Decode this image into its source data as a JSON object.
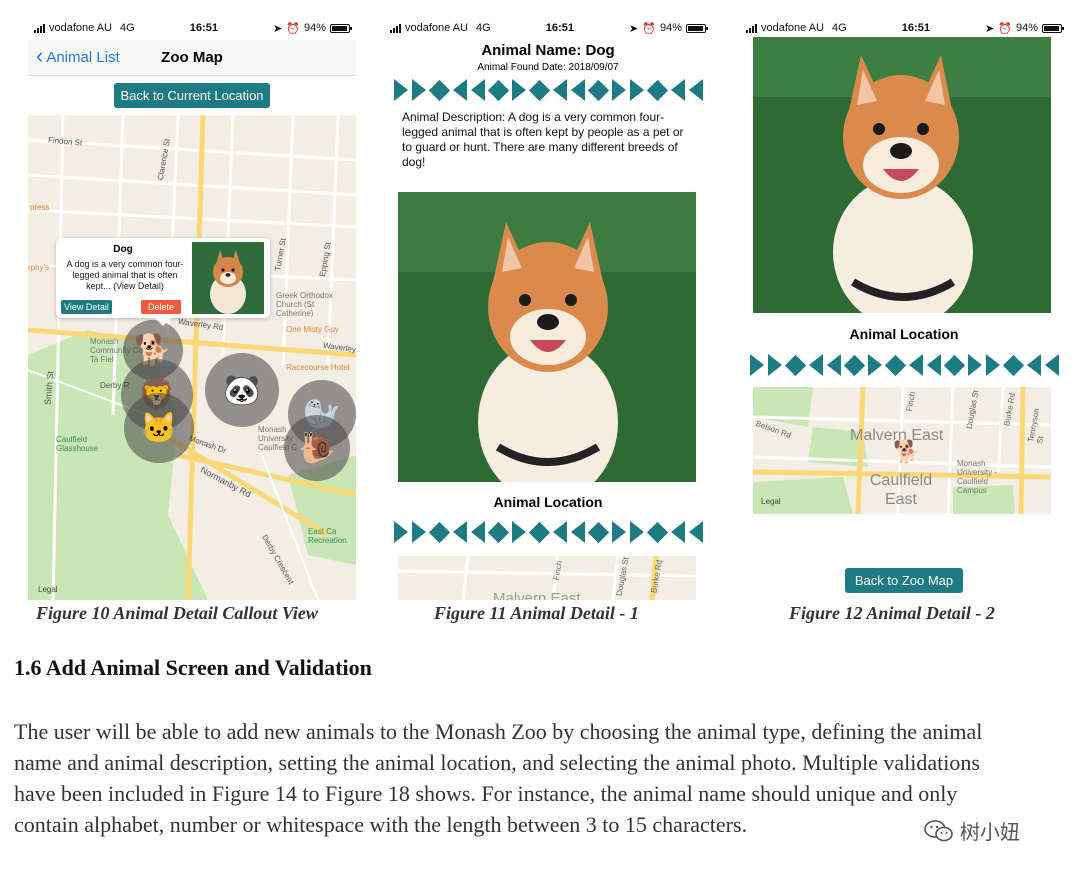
{
  "status": {
    "carrier": "vodafone AU",
    "network": "4G",
    "time": "16:51",
    "battery": "94%"
  },
  "fig10": {
    "back_label": "Animal List",
    "title": "Zoo Map",
    "current_location_button": "Back to Current Location",
    "callout": {
      "title": "Dog",
      "text": "A dog is a very common four-legged animal that is often kept... (View Detail)",
      "view_detail": "View Detail",
      "delete": "Delete"
    },
    "map_labels": {
      "findon": "Findon St",
      "clarence": "Clarence St",
      "press": "press",
      "murphys": "rphy's",
      "greek": "Greek Orthodox Church (St Catherine)",
      "one_misty": "One Misty Guy",
      "waverley1": "Waverley Rd",
      "waverley2": "Waverley",
      "monash_college": "Monash Community College Ta Fiel",
      "racecourse": "Racecourse Hotel",
      "smith": "Smith St",
      "derby": "Derby R",
      "monash_dr": "Monash Dr",
      "caulfield": "Caulfield Glasshouse",
      "normanby": "Normanby Rd",
      "monash_uni": "Monash University Caulfield C",
      "east_ca": "East Ca Recreation",
      "derby_cres": "Derby Crescent",
      "turner": "Turner St",
      "epping": "Epping St",
      "legal": "Legal"
    },
    "markers": [
      {
        "animal": "dog",
        "emoji": "🐕"
      },
      {
        "animal": "lion",
        "emoji": "🦁"
      },
      {
        "animal": "cat",
        "emoji": "🐱"
      },
      {
        "animal": "panda",
        "emoji": "🐼"
      },
      {
        "animal": "seal",
        "emoji": "🦭"
      },
      {
        "animal": "snail",
        "emoji": "🐌"
      }
    ],
    "caption": "Figure 10 Animal Detail Callout View"
  },
  "fig11": {
    "animal_name": "Animal Name: Dog",
    "found_date": "Animal Found Date: 2018/09/07",
    "description": "Animal Description: A dog is a very common four-legged animal that is often kept by people as a pet or to guard or hunt. There are many different breeds of dog!",
    "location_heading": "Animal Location",
    "map_labels": {
      "finch": "Finch",
      "douglas": "Douglas St",
      "burke": "Burke Rd",
      "malvern": "Malvern East"
    },
    "caption": "Figure 11 Animal Detail - 1"
  },
  "fig12": {
    "location_heading": "Animal Location",
    "map_labels": {
      "malvern": "Malvern East",
      "caulfield": "Caulfield East",
      "monash": "Monash University - Caulfield Campus",
      "finch": "Finch",
      "douglas": "Douglas St",
      "tennyson": "Tennyson St",
      "legal": "Legal",
      "belson": "Belson Rd",
      "burke": "Burke Rd"
    },
    "back_button": "Back to Zoo Map",
    "caption": "Figure 12 Animal Detail - 2"
  },
  "section": {
    "heading": "1.6 Add Animal Screen and Validation",
    "paragraph": "The user will be able to add new animals to the Monash Zoo by choosing the animal type, defining the animal name and animal description, setting the animal location, and selecting the animal photo. Multiple validations have been included in Figure 14 to Figure 18 shows. For instance, the animal name should unique and only contain alphabet, number or whitespace with the length between 3 to 15 characters."
  },
  "watermark": {
    "text": "树小妞",
    "icon": "wechat-icon"
  },
  "colors": {
    "teal": "#1e7a83",
    "ios_blue": "#1e7be6",
    "delete_red": "#f05a3c"
  }
}
